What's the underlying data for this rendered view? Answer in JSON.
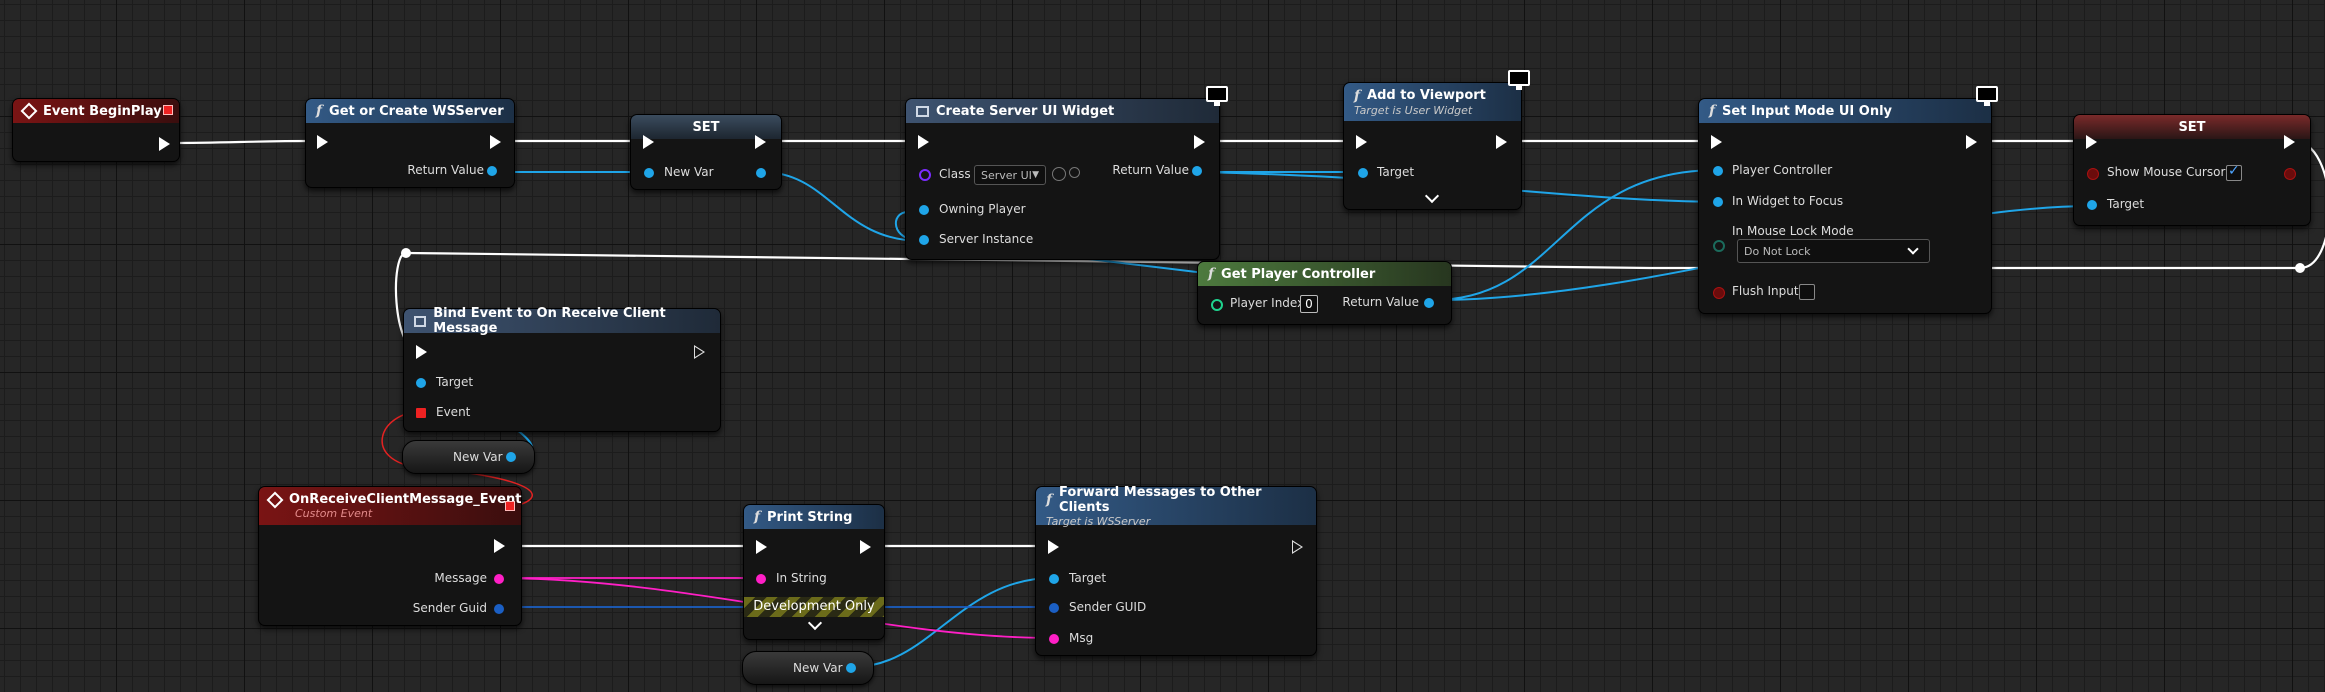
{
  "nodes": {
    "event_begin_play": {
      "title": "Event BeginPlay"
    },
    "get_or_create_wsserver": {
      "title": "Get or Create WSServer",
      "return_value": "Return Value"
    },
    "set_new_var": {
      "title": "SET",
      "new_var": "New Var"
    },
    "create_server_ui_widget": {
      "title": "Create Server UI Widget",
      "class_label": "Class",
      "class_value": "Server UI",
      "owning_player": "Owning Player",
      "server_instance": "Server Instance",
      "return_value": "Return Value"
    },
    "add_to_viewport": {
      "title": "Add to Viewport",
      "subtitle": "Target is User Widget",
      "target": "Target"
    },
    "set_input_mode": {
      "title": "Set Input Mode UI Only",
      "player_controller": "Player Controller",
      "in_widget_to_focus": "In Widget to Focus",
      "in_mouse_lock_mode": "In Mouse Lock Mode",
      "lock_mode_value": "Do Not Lock",
      "flush_input": "Flush Input"
    },
    "set_show_mouse_cursor": {
      "title": "SET",
      "show_mouse_cursor": "Show Mouse Cursor",
      "target": "Target"
    },
    "get_player_controller": {
      "title": "Get Player Controller",
      "player_index": "Player Index",
      "player_index_value": "0",
      "return_value": "Return Value"
    },
    "bind_event": {
      "title": "Bind Event to On Receive Client Message",
      "target": "Target",
      "event": "Event"
    },
    "new_var_getter_1": {
      "label": "New Var"
    },
    "on_receive_event": {
      "title": "OnReceiveClientMessage_Event",
      "subtitle": "Custom Event",
      "message": "Message",
      "sender_guid": "Sender Guid"
    },
    "print_string": {
      "title": "Print String",
      "in_string": "In String",
      "dev_only": "Development Only"
    },
    "new_var_getter_2": {
      "label": "New Var"
    },
    "forward_messages": {
      "title": "Forward Messages to Other Clients",
      "subtitle": "Target is WSServer",
      "target": "Target",
      "sender_guid": "Sender GUID",
      "msg": "Msg"
    }
  },
  "colors": {
    "exec_wire": "#ffffff",
    "object_wire": "#1fa5e8",
    "string_wire": "#ff1fc6",
    "guid_wire": "#1b5fc4",
    "delegate_wire": "#e22222"
  }
}
